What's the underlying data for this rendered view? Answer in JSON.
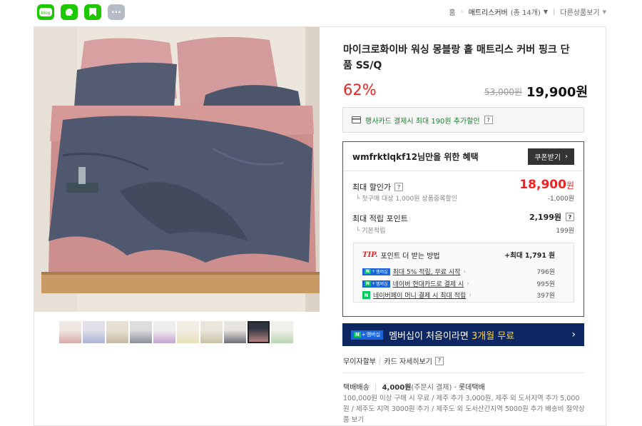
{
  "top_icons": [
    {
      "name": "blog-icon",
      "label": "blog"
    },
    {
      "name": "cafe-icon",
      "label": ""
    },
    {
      "name": "bookmark-icon",
      "label": ""
    },
    {
      "name": "more-icon",
      "label": "···"
    }
  ],
  "breadcrumb": {
    "home": "홈",
    "category": "매트리스커버",
    "count": "(총 14개)",
    "other": "다른상품보기"
  },
  "product": {
    "title": "마이크로화이바 워싱 몽블랑 홑 매트리스 커버 핑크 단품 SS/Q",
    "discount": "62%",
    "original_price": "53,000원",
    "price": "19,900원"
  },
  "card_promo": {
    "text": "행사카드 결제시 최대 190원 추가할인",
    "help": "?"
  },
  "benefit": {
    "heading": "wmfrktlqkf12님만을 위한 혜택",
    "coupon_button": "쿠폰받기",
    "max_discount_label": "최대 할인가",
    "max_discount_price": "18,900",
    "max_discount_unit": "원",
    "first_purchase": "첫구매 대상 1,000원 상품중복할인",
    "first_purchase_value": "-1,000원",
    "max_points_label": "최대 적립 포인트",
    "max_points_value": "2,199원",
    "basic_label": "기본적립",
    "basic_value": "199원",
    "tip_label": "TIP.",
    "tip_text": "포인트 더 받는 방법",
    "tip_total": "+최대 1,791 원",
    "tips": [
      {
        "badge": "멤버십",
        "text": "최대 5% 적립, 무료 시작",
        "value": "796원"
      },
      {
        "badge": "멤버십",
        "text": "네이버 현대카드로 결제 시",
        "value": "995원"
      },
      {
        "badge": "",
        "text": "네이버페이 머니 결제 시 최대 적립",
        "value": "397원"
      }
    ]
  },
  "membership_banner": {
    "badge": "멤버십",
    "text": "멤버십이 처음이라면 ",
    "highlight": "3개월 무료"
  },
  "links": {
    "installment": "무이자할부",
    "card_detail": "카드 자세히보기"
  },
  "shipping": {
    "label": "택배배송",
    "fee": "4,000원",
    "fee_note": "(주문시 결제)",
    "carrier": "롯데택배",
    "details": "100,000원 이상 구매 시 무료 / 제주 추가 3,000원, 제주 외 도서지역 추가 5,000원 / 제주도 지역 3000원 추가 / 제주도 외 도서산간지역 5000원 추가 배송비 절약상품 보기"
  },
  "colors": {
    "discount": "#ee2222",
    "membership_bg": "#0d2763",
    "naver_green": "#03c75a",
    "highlight": "#ffd43b"
  }
}
